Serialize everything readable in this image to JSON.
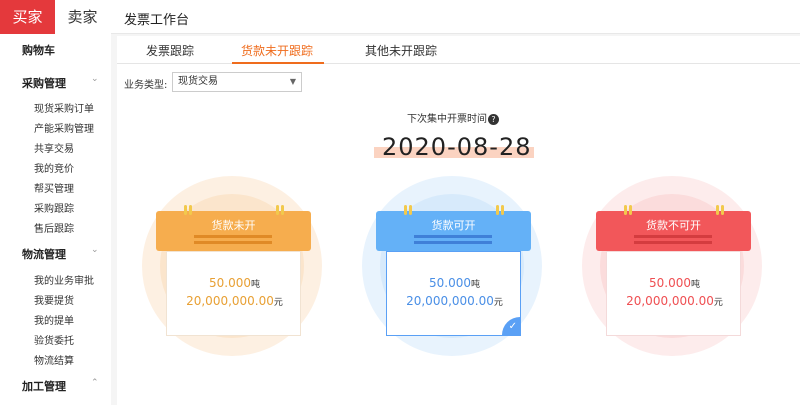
{
  "sidebar": {
    "role_tabs": [
      {
        "label": "买家"
      },
      {
        "label": "卖家"
      }
    ],
    "cart": "购物车",
    "groups": [
      {
        "title": "采购管理",
        "items": [
          "现货采购订单",
          "产能采购管理",
          "共享交易",
          "我的竞价",
          "帮买管理",
          "采购跟踪",
          "售后跟踪"
        ]
      },
      {
        "title": "物流管理",
        "items": [
          "我的业务审批",
          "我要提货",
          "我的提单",
          "验货委托",
          "物流结算"
        ]
      },
      {
        "title": "加工管理",
        "items": []
      }
    ]
  },
  "header": {
    "title": "发票工作台"
  },
  "tabs": [
    {
      "label": "发票跟踪"
    },
    {
      "label": "货款未开跟踪"
    },
    {
      "label": "其他未开跟踪"
    }
  ],
  "filter": {
    "label": "业务类型:",
    "value": "现货交易"
  },
  "next_invoice": {
    "label": "下次集中开票时间",
    "date": "2020-08-28"
  },
  "cards": [
    {
      "title": "货款未开",
      "amount": "50.000",
      "amount_unit": "吨",
      "money": "20,000,000.00",
      "money_unit": "元",
      "color": "#f4a84a"
    },
    {
      "title": "货款可开",
      "amount": "50.000",
      "amount_unit": "吨",
      "money": "20,000,000.00",
      "money_unit": "元",
      "color": "#5aa0f5"
    },
    {
      "title": "货款不可开",
      "amount": "50.000",
      "amount_unit": "吨",
      "money": "20,000,000.00",
      "money_unit": "元",
      "color": "#ef5a5a"
    }
  ]
}
